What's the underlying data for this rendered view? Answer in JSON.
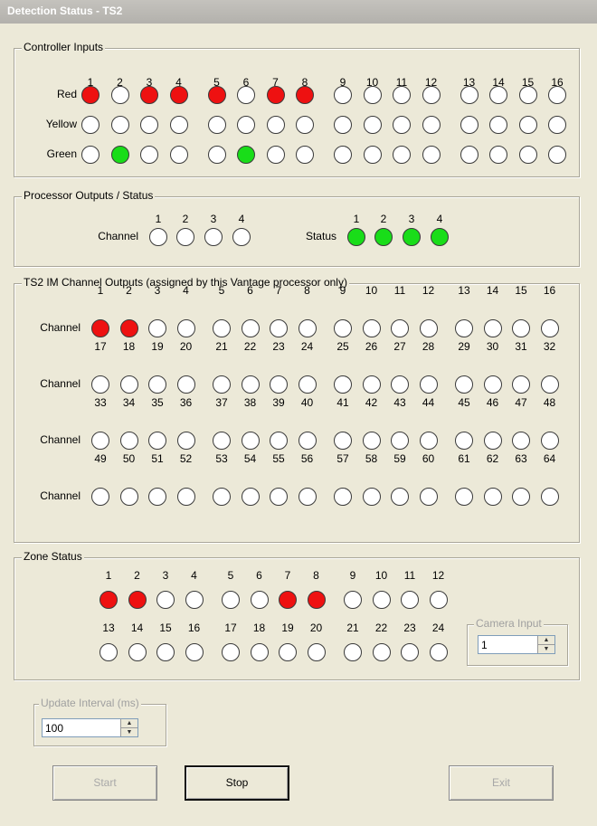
{
  "window": {
    "title": "Detection Status - TS2"
  },
  "controller_inputs": {
    "legend": "Controller Inputs",
    "numbers": [
      "1",
      "2",
      "3",
      "4",
      "5",
      "6",
      "7",
      "8",
      "9",
      "10",
      "11",
      "12",
      "13",
      "14",
      "15",
      "16"
    ],
    "rows": [
      {
        "label": "Red",
        "states": [
          "red",
          "off",
          "red",
          "red",
          "red",
          "off",
          "red",
          "red",
          "off",
          "off",
          "off",
          "off",
          "off",
          "off",
          "off",
          "off"
        ]
      },
      {
        "label": "Yellow",
        "states": [
          "off",
          "off",
          "off",
          "off",
          "off",
          "off",
          "off",
          "off",
          "off",
          "off",
          "off",
          "off",
          "off",
          "off",
          "off",
          "off"
        ]
      },
      {
        "label": "Green",
        "states": [
          "off",
          "green",
          "off",
          "off",
          "off",
          "green",
          "off",
          "off",
          "off",
          "off",
          "off",
          "off",
          "off",
          "off",
          "off",
          "off"
        ]
      }
    ]
  },
  "processor_outputs": {
    "legend": "Processor Outputs / Status",
    "channel_label": "Channel",
    "channel_numbers": [
      "1",
      "2",
      "3",
      "4"
    ],
    "channel_states": [
      "off",
      "off",
      "off",
      "off"
    ],
    "status_label": "Status",
    "status_numbers": [
      "1",
      "2",
      "3",
      "4"
    ],
    "status_states": [
      "green",
      "green",
      "green",
      "green"
    ]
  },
  "ts2_outputs": {
    "legend": "TS2 IM Channel Outputs (assigned by this Vantage processor only)",
    "row_label": "Channel",
    "rows": [
      {
        "numbers": [
          "1",
          "2",
          "3",
          "4",
          "5",
          "6",
          "7",
          "8",
          "9",
          "10",
          "11",
          "12",
          "13",
          "14",
          "15",
          "16"
        ],
        "states": [
          "red",
          "red",
          "off",
          "off",
          "off",
          "off",
          "off",
          "off",
          "off",
          "off",
          "off",
          "off",
          "off",
          "off",
          "off",
          "off"
        ]
      },
      {
        "numbers": [
          "17",
          "18",
          "19",
          "20",
          "21",
          "22",
          "23",
          "24",
          "25",
          "26",
          "27",
          "28",
          "29",
          "30",
          "31",
          "32"
        ],
        "states": [
          "off",
          "off",
          "off",
          "off",
          "off",
          "off",
          "off",
          "off",
          "off",
          "off",
          "off",
          "off",
          "off",
          "off",
          "off",
          "off"
        ]
      },
      {
        "numbers": [
          "33",
          "34",
          "35",
          "36",
          "37",
          "38",
          "39",
          "40",
          "41",
          "42",
          "43",
          "44",
          "45",
          "46",
          "47",
          "48"
        ],
        "states": [
          "off",
          "off",
          "off",
          "off",
          "off",
          "off",
          "off",
          "off",
          "off",
          "off",
          "off",
          "off",
          "off",
          "off",
          "off",
          "off"
        ]
      },
      {
        "numbers": [
          "49",
          "50",
          "51",
          "52",
          "53",
          "54",
          "55",
          "56",
          "57",
          "58",
          "59",
          "60",
          "61",
          "62",
          "63",
          "64"
        ],
        "states": [
          "off",
          "off",
          "off",
          "off",
          "off",
          "off",
          "off",
          "off",
          "off",
          "off",
          "off",
          "off",
          "off",
          "off",
          "off",
          "off"
        ]
      }
    ]
  },
  "zone_status": {
    "legend": "Zone Status",
    "rows": [
      {
        "numbers": [
          "1",
          "2",
          "3",
          "4",
          "5",
          "6",
          "7",
          "8",
          "9",
          "10",
          "11",
          "12"
        ],
        "states": [
          "red",
          "red",
          "off",
          "off",
          "off",
          "off",
          "red",
          "red",
          "off",
          "off",
          "off",
          "off"
        ]
      },
      {
        "numbers": [
          "13",
          "14",
          "15",
          "16",
          "17",
          "18",
          "19",
          "20",
          "21",
          "22",
          "23",
          "24"
        ],
        "states": [
          "off",
          "off",
          "off",
          "off",
          "off",
          "off",
          "off",
          "off",
          "off",
          "off",
          "off",
          "off"
        ]
      }
    ],
    "camera_input": {
      "legend": "Camera Input",
      "value": "1"
    }
  },
  "update_interval": {
    "legend": "Update Interval (ms)",
    "value": "100"
  },
  "buttons": {
    "start": "Start",
    "stop": "Stop",
    "exit": "Exit"
  },
  "colors": {
    "red": "#ee1111",
    "green": "#19dd19",
    "off": "#ffffff"
  }
}
